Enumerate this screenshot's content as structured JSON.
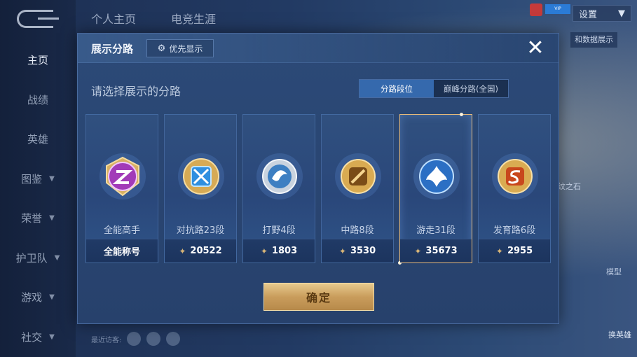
{
  "background": {
    "sidebar": [
      {
        "label": "主页",
        "active": true,
        "chevron": false
      },
      {
        "label": "战绩",
        "active": false,
        "chevron": false
      },
      {
        "label": "英雄",
        "active": false,
        "chevron": false
      },
      {
        "label": "图鉴",
        "active": false,
        "chevron": true
      },
      {
        "label": "荣誉",
        "active": false,
        "chevron": true
      },
      {
        "label": "护卫队",
        "active": false,
        "chevron": true
      },
      {
        "label": "游戏",
        "active": false,
        "chevron": true
      },
      {
        "label": "社交",
        "active": false,
        "chevron": true
      }
    ],
    "top_tabs": [
      "个人主页",
      "电竞生涯"
    ],
    "settings_label": "设置",
    "vip_text": "VIP",
    "display_btn": "和数据展示",
    "stone_label": "铭纹之石",
    "model_label": "模型",
    "change_hero": "换英雄",
    "visitors_label": "最近访客:"
  },
  "dialog": {
    "title": "展示分路",
    "priority_label": "优先显示",
    "close_symbol": "✕",
    "subtitle": "请选择展示的分路",
    "segments": [
      {
        "label": "分路段位",
        "active": true
      },
      {
        "label": "巅峰分路(全国)",
        "active": false
      }
    ],
    "cards": [
      {
        "name": "全能高手",
        "foot": "全能称号",
        "score": "",
        "badge": "purple",
        "selected": false
      },
      {
        "name": "对抗路23段",
        "foot": "",
        "score": "20522",
        "badge": "gold-blue",
        "selected": false
      },
      {
        "name": "打野4段",
        "foot": "",
        "score": "1803",
        "badge": "silver",
        "selected": false
      },
      {
        "name": "中路8段",
        "foot": "",
        "score": "3530",
        "badge": "gold",
        "selected": false
      },
      {
        "name": "游走31段",
        "foot": "",
        "score": "35673",
        "badge": "blue",
        "selected": true
      },
      {
        "name": "发育路6段",
        "foot": "",
        "score": "2955",
        "badge": "gold",
        "selected": false
      }
    ],
    "confirm_label": "确定"
  }
}
